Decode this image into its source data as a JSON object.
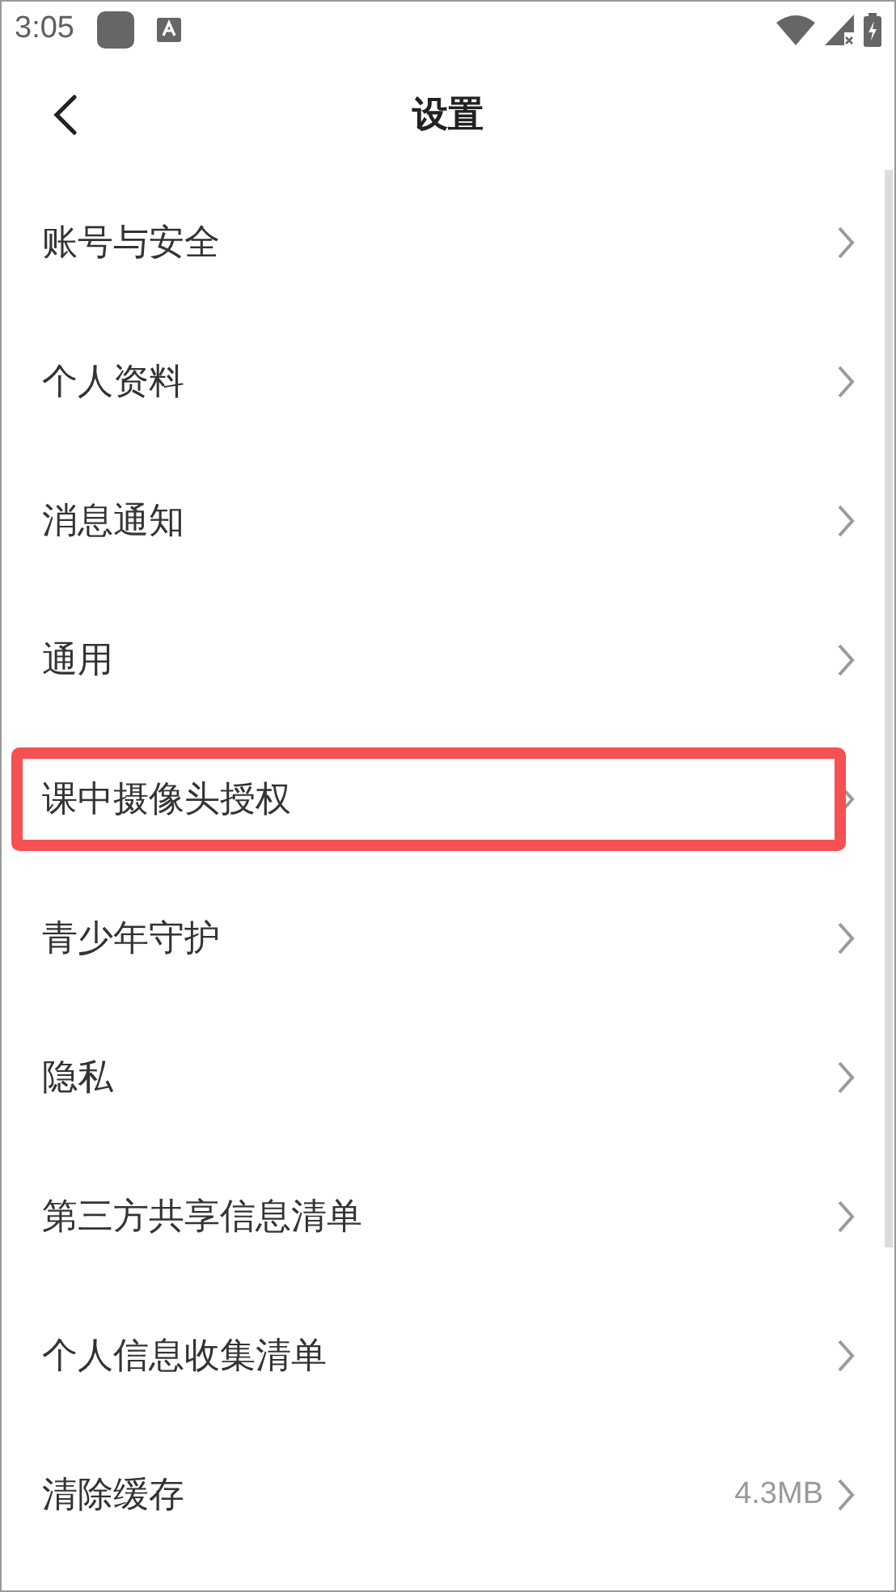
{
  "status_bar": {
    "time": "3:05"
  },
  "header": {
    "title": "设置"
  },
  "items": [
    {
      "label": "账号与安全",
      "highlighted": false
    },
    {
      "label": "个人资料",
      "highlighted": false
    },
    {
      "label": "消息通知",
      "highlighted": false
    },
    {
      "label": "通用",
      "highlighted": false
    },
    {
      "label": "课中摄像头授权",
      "highlighted": true
    },
    {
      "label": "青少年守护",
      "highlighted": false
    },
    {
      "label": "隐私",
      "highlighted": false
    },
    {
      "label": "第三方共享信息清单",
      "highlighted": false
    },
    {
      "label": "个人信息收集清单",
      "highlighted": false
    },
    {
      "label": "清除缓存",
      "value": "4.3MB",
      "highlighted": false
    }
  ]
}
